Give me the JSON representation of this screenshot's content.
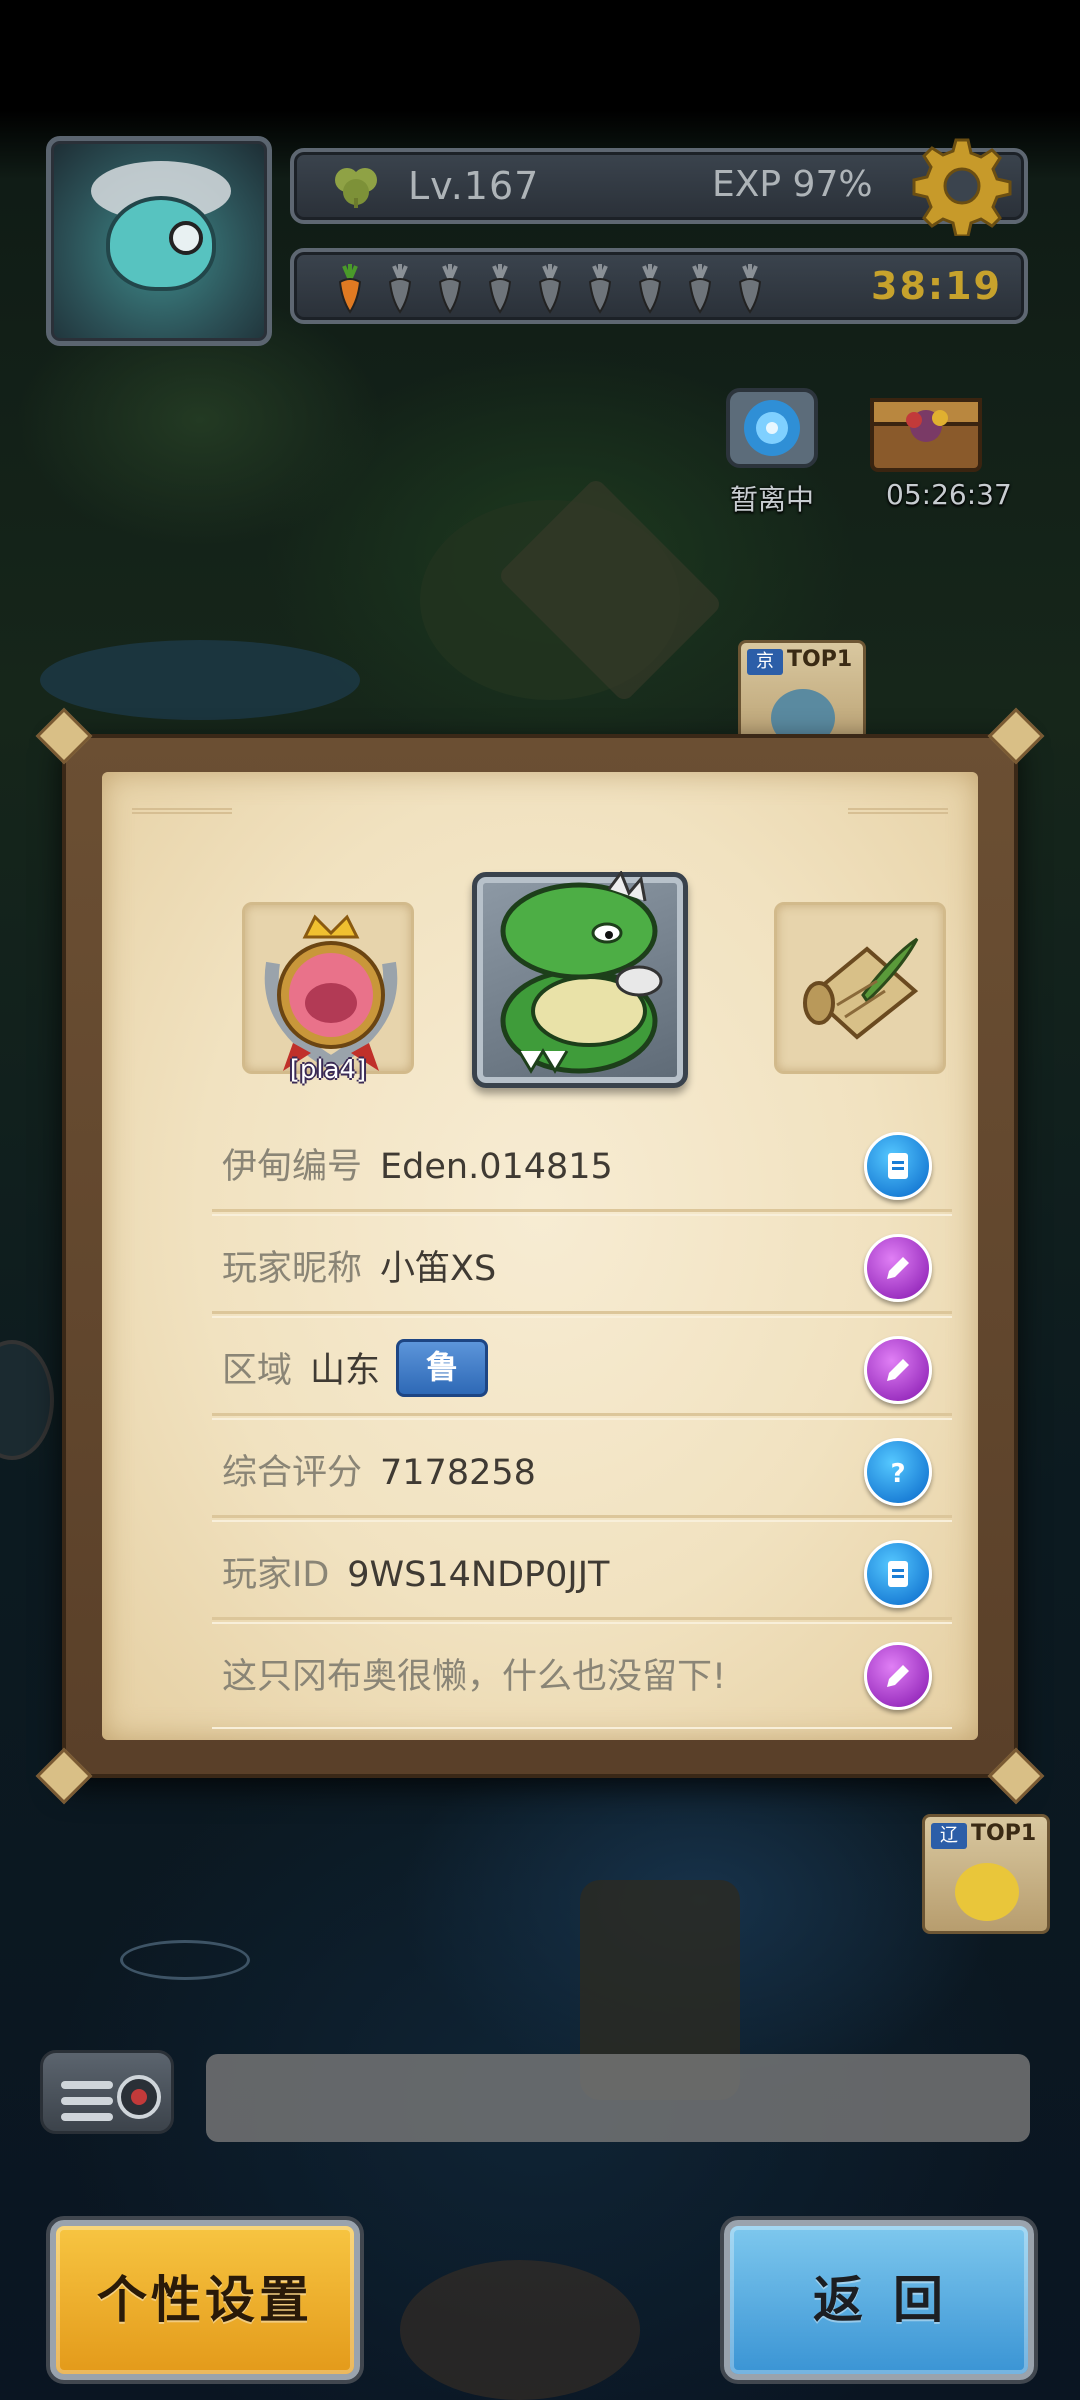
{
  "hud": {
    "level": "Lv.167",
    "exp": "EXP 97%",
    "energy_timer": "38:19",
    "energy_full": 1,
    "energy_total": 9
  },
  "map": {
    "portal_label": "暂离中",
    "chest_timer": "05:26:37",
    "banners": [
      {
        "tag": "京",
        "rank": "TOP1"
      },
      {
        "tag": "辽",
        "rank": "TOP1"
      }
    ]
  },
  "profile": {
    "badge_label": "[pla4]",
    "rows": [
      {
        "label": "伊甸编号",
        "value": "Eden.014815",
        "action": "copy-icon"
      },
      {
        "label": "玩家昵称",
        "value": "小笛XS",
        "action": "edit-icon"
      },
      {
        "label": "区域",
        "value": "山东",
        "tag": "鲁",
        "action": "edit-icon"
      },
      {
        "label": "综合评分",
        "value": "7178258",
        "action": "help-icon"
      },
      {
        "label": "玩家ID",
        "value": "9WS14NDP0JJT",
        "action": "copy-icon"
      },
      {
        "label": "这只冈布奥很懒，什么也没留下!",
        "value": "",
        "action": "edit-icon"
      }
    ]
  },
  "chat": {
    "placeholder": ""
  },
  "buttons": {
    "settings": "个性设置",
    "back": "返回"
  },
  "colors": {
    "panel_paper": "#f1e2c0",
    "settings_button": "#f0b432",
    "back_button": "#5fb0e2",
    "timer": "#c7a22c"
  }
}
